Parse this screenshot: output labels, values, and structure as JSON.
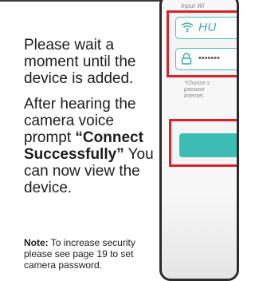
{
  "manual": {
    "wait_text": "Please wait a moment until the device is added.",
    "prompt_before": "After hearing the camera voice prompt ",
    "prompt_quote": "“Connect Successfully”",
    "prompt_after": " You can now view the device.",
    "note_label": "Note:",
    "note_text": " To increase security please see page 19 to set camera password."
  },
  "phone": {
    "heading": "Input Wi",
    "ssid_value": "HU",
    "password_mask": "•••••••",
    "hint_lines": [
      "*Choose s",
      "passwor",
      "internet."
    ],
    "accent_color": "#3cbcb2",
    "highlight_color": "#d6222a"
  }
}
